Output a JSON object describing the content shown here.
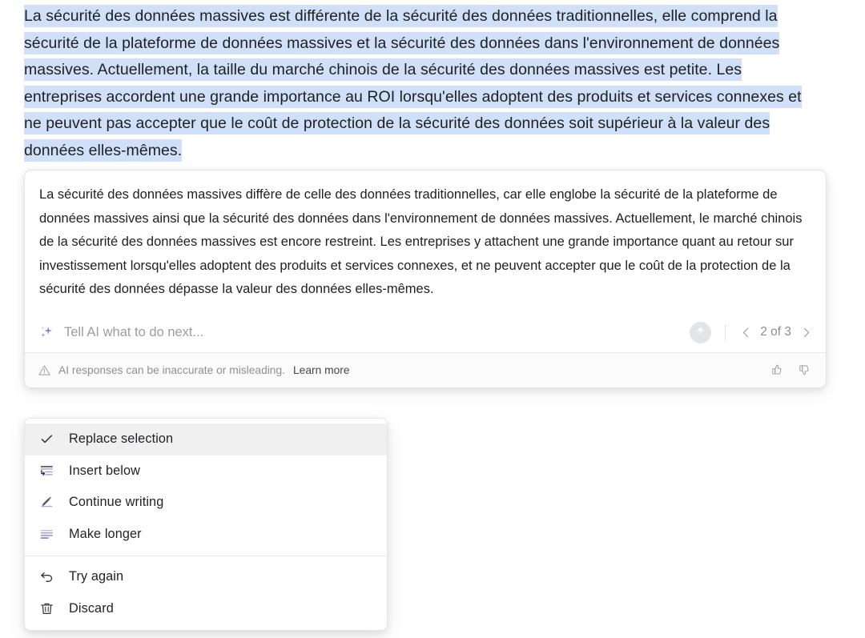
{
  "document": {
    "selected_text": "La sécurité des données massives est différente de la sécurité des données traditionnelles, elle comprend la sécurité de la plateforme de données massives et la sécurité des données dans l'environnement de données massives. Actuellement, la taille du marché chinois de la sécurité des données massives est petite. Les entreprises accordent une grande importance au ROI lorsqu'elles adoptent des produits et services connexes et ne peuvent pas accepter que le coût de protection de la sécurité des données soit supérieur à la valeur des données elles-mêmes.",
    "selection_highlight_color": "#cfe0f8"
  },
  "ai_card": {
    "response_text": "La sécurité des données massives diffère de celle des données traditionnelles, car elle englobe la sécurité de la plateforme de données massives ainsi que la sécurité des données dans l'environnement de données massives. Actuellement, le marché chinois de la sécurité des données massives est encore restreint. Les entreprises y attachent une grande importance quant au retour sur investissement lorsqu'elles adoptent des produits et services connexes, et ne peuvent accepter que le coût de la protection de la sécurité des données dépasse la valeur des données elles-mêmes.",
    "prompt": {
      "icon": "sparkle-icon",
      "placeholder": "Tell AI what to do next...",
      "value": "",
      "accent_color": "#8b7fd4"
    },
    "submit": {
      "icon": "arrow-up-icon",
      "background_color": "#e3e4e6"
    },
    "pager": {
      "prev_icon": "chevron-left-icon",
      "next_icon": "chevron-right-icon",
      "label": "2 of 3",
      "current": 2,
      "total": 3
    },
    "disclaimer": {
      "icon": "warning-triangle-icon",
      "text": "AI responses can be inaccurate or misleading.",
      "learn_more_label": "Learn more"
    },
    "feedback": {
      "thumbs_up_icon": "thumbs-up-icon",
      "thumbs_down_icon": "thumbs-down-icon"
    }
  },
  "menu": {
    "groups": [
      {
        "items": [
          {
            "label": "Replace selection",
            "icon": "check-icon",
            "active": true
          },
          {
            "label": "Insert below",
            "icon": "insert-below-icon",
            "active": false
          },
          {
            "label": "Continue writing",
            "icon": "pencil-icon",
            "active": false
          },
          {
            "label": "Make longer",
            "icon": "make-longer-icon",
            "active": false
          }
        ]
      },
      {
        "items": [
          {
            "label": "Try again",
            "icon": "undo-arrow-icon",
            "active": false
          },
          {
            "label": "Discard",
            "icon": "trash-icon",
            "active": false
          }
        ]
      }
    ],
    "accent_color": "#8b7fd4"
  }
}
